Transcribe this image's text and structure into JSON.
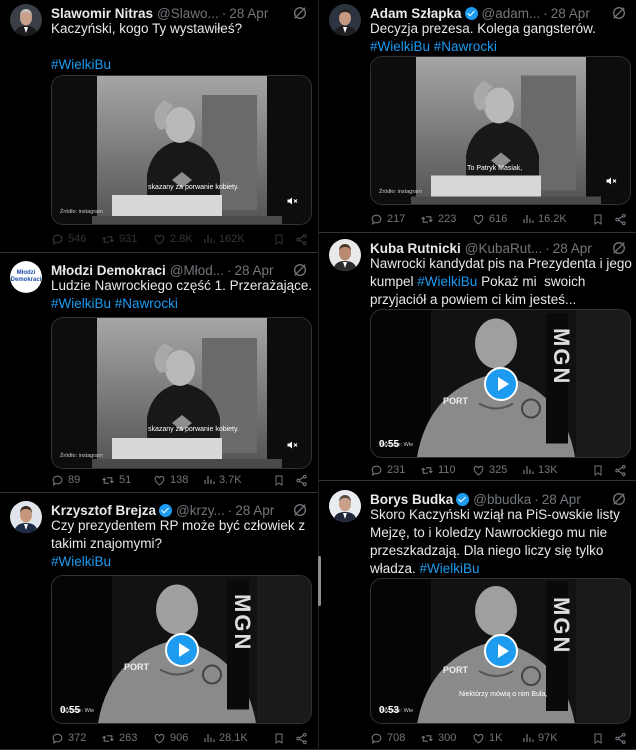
{
  "tweets_left": [
    {
      "name": "Slawomir Nitras",
      "verified": false,
      "handle": "@Slawo...",
      "date": "28 Apr",
      "lines": [
        [
          "Kaczyński, kogo Ty wystawiłeś?"
        ],
        [],
        [
          {
            "t": "#WielkiBu",
            "tag": true
          }
        ]
      ],
      "video": {
        "subtitle": "skazany za porwanie kobiety.",
        "source": "Źródło: instagram",
        "duration": ""
      },
      "stats": {
        "replies": "546",
        "reposts": "931",
        "likes": "2.8K",
        "views": "162K"
      }
    },
    {
      "name": "Młodzi Demokraci",
      "verified": false,
      "handle": "@Młod...",
      "date": "28 Apr",
      "lines": [
        [
          "Ludzie Nawrockiego część 1. Przerażające."
        ],
        [
          {
            "t": "#WielkiBu",
            "tag": true
          },
          {
            "t": " "
          },
          {
            "t": "#Nawrocki",
            "tag": true
          }
        ]
      ],
      "video": {
        "subtitle": "skazany za porwanie kobiety.",
        "source": "Źródło: instagram",
        "duration": ""
      },
      "stats": {
        "replies": "89",
        "reposts": "51",
        "likes": "138",
        "views": "3.7K"
      }
    },
    {
      "name": "Krzysztof Brejza",
      "verified": true,
      "handle": "@krzy...",
      "date": "28 Apr",
      "lines": [
        [
          "Czy prezydentem RP może być człowiek z"
        ],
        [
          "takimi znajomymi?"
        ],
        [
          {
            "t": "#WielkiBu",
            "tag": true
          }
        ]
      ],
      "video": {
        "subtitle": "",
        "source": "YouTube: Wie",
        "duration": "0:55"
      },
      "stats": {
        "replies": "372",
        "reposts": "263",
        "likes": "906",
        "views": "28.1K"
      }
    }
  ],
  "tweets_right": [
    {
      "name": "Adam Szłapka",
      "verified": true,
      "handle": "@adam...",
      "date": "28 Apr",
      "lines": [
        [
          "Decyzja prezesa. Kolega gangsterów."
        ],
        [
          {
            "t": "#WielkiBu",
            "tag": true
          },
          {
            "t": " "
          },
          {
            "t": "#Nawrocki",
            "tag": true
          }
        ]
      ],
      "video": {
        "subtitle": "To Patryk Masiak,",
        "source": "Źródło: instagram",
        "duration": ""
      },
      "stats": {
        "replies": "217",
        "reposts": "223",
        "likes": "616",
        "views": "16.2K"
      }
    },
    {
      "name": "Kuba Rutnicki",
      "verified": false,
      "handle": "@KubaRut...",
      "date": "28 Apr",
      "lines": [
        [
          "Nawrocki kandydat pis na Prezydenta i jego"
        ],
        [
          {
            "t": "kumpel "
          },
          {
            "t": "#WielkiBu",
            "tag": true
          },
          {
            "t": " Pokaż mi  swoich"
          }
        ],
        [
          "przyjaciół a powiem ci kim jesteś..."
        ]
      ],
      "video": {
        "subtitle": "",
        "source": "YouTube: Wie",
        "duration": "0:55"
      },
      "stats": {
        "replies": "231",
        "reposts": "110",
        "likes": "325",
        "views": "13K"
      }
    },
    {
      "name": "Borys Budka",
      "verified": true,
      "handle": "@bbudka",
      "date": "28 Apr",
      "lines": [
        [
          "Skoro Kaczyński wziął na PiS-owskie listy"
        ],
        [
          "Mejzę, to i koledzy Nawrockiego mu nie"
        ],
        [
          "przeszkadzają. Dla niego liczy się tylko"
        ],
        [
          {
            "t": "władza. "
          },
          {
            "t": "#WielkiBu",
            "tag": true
          }
        ]
      ],
      "video": {
        "subtitle": "Niektórzy mówią o nim Buła,",
        "source": "YouTube: Wie",
        "duration": "0:53"
      },
      "stats": {
        "replies": "708",
        "reposts": "300",
        "likes": "1K",
        "views": "97K"
      }
    }
  ],
  "avatar_labels": {
    "mlodzi_line1": "Młodzi",
    "mlodzi_line2": "Demokraci"
  },
  "video_overlay_text": {
    "brand": "MGN",
    "banner": "PORT"
  },
  "colors": {
    "accent": "#1d9bf0",
    "muted": "#71767b",
    "text": "#e7e9ea",
    "background": "#000000"
  },
  "icons": [
    "grok-icon",
    "reply-icon",
    "repost-icon",
    "like-icon",
    "views-icon",
    "bookmark-icon",
    "share-icon",
    "mute-icon",
    "play-icon",
    "verified-badge-icon"
  ]
}
